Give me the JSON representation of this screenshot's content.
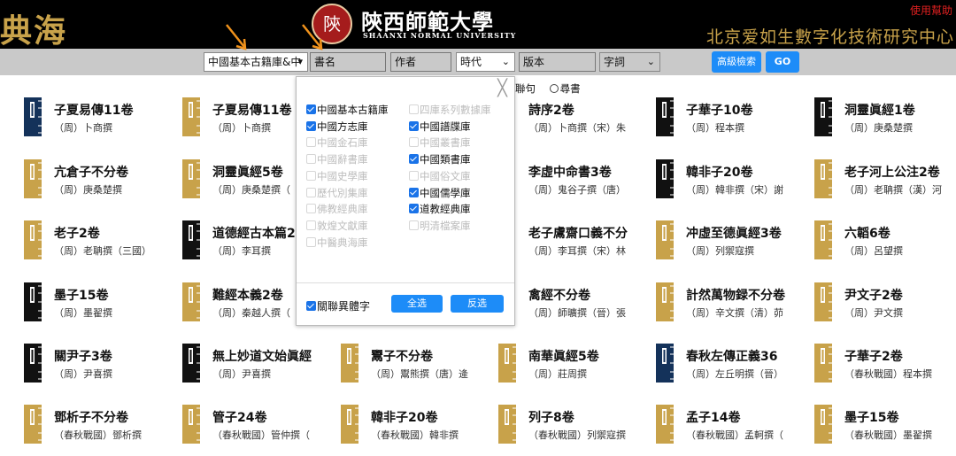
{
  "header": {
    "brand_left": "典海",
    "logo_seal": "陝",
    "university_cn": "陝西師範大學",
    "university_en": "SHAANXI NORMAL UNIVERSITY",
    "help_link": "使用幫助",
    "org_name": "北京爱如生數字化技術研究中心"
  },
  "search": {
    "scope_value": "中國基本古籍庫&中",
    "title_placeholder": "書名",
    "author_placeholder": "作者",
    "era_value": "時代",
    "edition_placeholder": "版本",
    "field_value": "字詞",
    "advanced_button": "高級檢索",
    "go_button": "GO"
  },
  "radio_options": [
    "聯句",
    "尋書"
  ],
  "scope_panel": {
    "left_options": [
      {
        "label": "中國基本古籍庫",
        "checked": true,
        "enabled": true
      },
      {
        "label": "中國方志庫",
        "checked": true,
        "enabled": true
      },
      {
        "label": "中國金石庫",
        "checked": false,
        "enabled": false
      },
      {
        "label": "中國辭書庫",
        "checked": false,
        "enabled": false
      },
      {
        "label": "中國史學庫",
        "checked": false,
        "enabled": false
      },
      {
        "label": "歷代別集庫",
        "checked": false,
        "enabled": false
      },
      {
        "label": "佛教經典庫",
        "checked": false,
        "enabled": false
      },
      {
        "label": "敦煌文獻庫",
        "checked": false,
        "enabled": false
      },
      {
        "label": "中醫典海庫",
        "checked": false,
        "enabled": false
      }
    ],
    "right_options": [
      {
        "label": "四庫系列數據庫",
        "checked": false,
        "enabled": false
      },
      {
        "label": "中國譜牒庫",
        "checked": true,
        "enabled": true
      },
      {
        "label": "中國叢書庫",
        "checked": false,
        "enabled": false
      },
      {
        "label": "中國類書庫",
        "checked": true,
        "enabled": true
      },
      {
        "label": "中國俗文庫",
        "checked": false,
        "enabled": false
      },
      {
        "label": "中國儒學庫",
        "checked": true,
        "enabled": true
      },
      {
        "label": "道教經典庫",
        "checked": true,
        "enabled": true
      },
      {
        "label": "明清檔案庫",
        "checked": false,
        "enabled": false
      }
    ],
    "variant_label": "關聯異體字",
    "select_all": "全选",
    "invert": "反选"
  },
  "colors": {
    "gold": "#c8a24a",
    "navy": "#14325a",
    "black": "#111111",
    "accent": "#1d8cf8"
  },
  "books": [
    [
      {
        "title": "子夏易傳11卷",
        "author": "（周）卜商撰",
        "icon": "navy"
      },
      {
        "title": "子夏易傳11卷",
        "author": "（周）卜商撰",
        "icon": "gold"
      },
      {
        "title": "",
        "author": "",
        "icon": "hidden"
      },
      {
        "title": "詩序2卷",
        "author": "（周）卜商撰（宋）朱",
        "icon": "hidden"
      },
      {
        "title": "子華子10卷",
        "author": "（周）程本撰",
        "icon": "black"
      },
      {
        "title": "洞靈眞經1卷",
        "author": "（周）庚桑楚撰",
        "icon": "black"
      }
    ],
    [
      {
        "title": "亢倉子不分卷",
        "author": "（周）庚桑楚撰",
        "icon": "gold"
      },
      {
        "title": "洞靈眞經5卷",
        "author": "（周）庚桑楚撰（",
        "icon": "gold"
      },
      {
        "title": "",
        "author": "",
        "icon": "hidden"
      },
      {
        "title": "李虛中命書3卷",
        "author": "（周）鬼谷子撰（唐）",
        "icon": "hidden"
      },
      {
        "title": "韓非子20卷",
        "author": "（周）韓非撰（宋）謝",
        "icon": "black"
      },
      {
        "title": "老子河上公注2卷",
        "author": "（周）老聃撰（漢）河",
        "icon": "gold"
      }
    ],
    [
      {
        "title": "老子2卷",
        "author": "（周）老聃撰（三國）",
        "icon": "gold"
      },
      {
        "title": "道德經古本篇2",
        "author": "（周）李耳撰",
        "icon": "black"
      },
      {
        "title": "",
        "author": "",
        "icon": "hidden"
      },
      {
        "title": "老子鬳齋口義不分",
        "author": "（周）李耳撰（宋）林",
        "icon": "hidden"
      },
      {
        "title": "冲虛至德眞經3卷",
        "author": "（周）列禦寇撰",
        "icon": "gold"
      },
      {
        "title": "六韜6卷",
        "author": "（周）呂望撰",
        "icon": "gold"
      }
    ],
    [
      {
        "title": "墨子15卷",
        "author": "（周）墨翟撰",
        "icon": "black"
      },
      {
        "title": "難經本義2卷",
        "author": "（周）秦越人撰（",
        "icon": "gold"
      },
      {
        "title": "",
        "author": "",
        "icon": "hidden"
      },
      {
        "title": "禽經不分卷",
        "author": "（周）師曠撰（晉）張",
        "icon": "hidden"
      },
      {
        "title": "計然萬物録不分卷",
        "author": "（周）辛文撰（清）茆",
        "icon": "gold"
      },
      {
        "title": "尹文子2卷",
        "author": "（周）尹文撰",
        "icon": "gold"
      }
    ],
    [
      {
        "title": "關尹子3卷",
        "author": "（周）尹喜撰",
        "icon": "black"
      },
      {
        "title": "無上妙道文始眞經",
        "author": "（周）尹喜撰",
        "icon": "black"
      },
      {
        "title": "鬻子不分卷",
        "author": "（周）鬻熊撰（唐）逄",
        "icon": "gold"
      },
      {
        "title": "南華眞經5卷",
        "author": "（周）莊周撰",
        "icon": "gold"
      },
      {
        "title": "春秋左傳正義36",
        "author": "（周）左丘明撰（晉）",
        "icon": "navy"
      },
      {
        "title": "子華子2卷",
        "author": "（春秋戰國）程本撰",
        "icon": "gold"
      }
    ],
    [
      {
        "title": "鄧析子不分卷",
        "author": "（春秋戰國）鄧析撰",
        "icon": "gold"
      },
      {
        "title": "管子24卷",
        "author": "（春秋戰國）管仲撰（",
        "icon": "gold"
      },
      {
        "title": "韓非子20卷",
        "author": "（春秋戰國）韓非撰",
        "icon": "gold"
      },
      {
        "title": "列子8卷",
        "author": "（春秋戰國）列禦寇撰",
        "icon": "gold"
      },
      {
        "title": "孟子14卷",
        "author": "（春秋戰國）孟軻撰（",
        "icon": "gold"
      },
      {
        "title": "墨子15卷",
        "author": "（春秋戰國）墨翟撰",
        "icon": "gold"
      }
    ]
  ]
}
